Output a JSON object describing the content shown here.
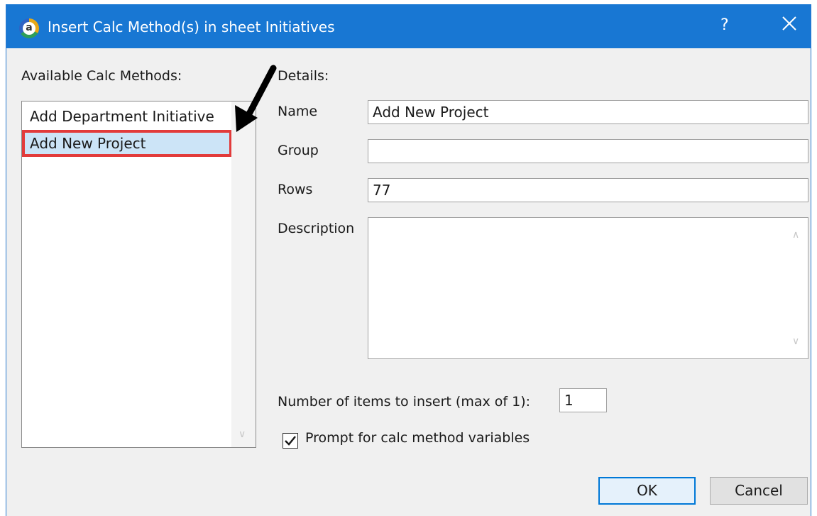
{
  "window": {
    "title": "Insert Calc Method(s) in sheet Initiatives",
    "app_icon_letter": "a",
    "help_glyph": "?"
  },
  "left_panel": {
    "heading": "Available Calc Methods:",
    "items": [
      {
        "label": "Add Department Initiative",
        "selected": false
      },
      {
        "label": "Add New Project",
        "selected": true
      }
    ]
  },
  "details": {
    "heading": "Details:",
    "name": {
      "label": "Name",
      "value": "Add New Project"
    },
    "group": {
      "label": "Group",
      "value": ""
    },
    "rows": {
      "label": "Rows",
      "value": "77"
    },
    "description": {
      "label": "Description",
      "value": ""
    }
  },
  "options": {
    "count_label": "Number of items to insert (max of 1):",
    "count_value": "1",
    "prompt_label": "Prompt for calc method variables",
    "prompt_checked": true
  },
  "buttons": {
    "ok": "OK",
    "cancel": "Cancel"
  },
  "annotation": {
    "arrow_color": "#000000",
    "highlight_color": "#e23b3b"
  }
}
